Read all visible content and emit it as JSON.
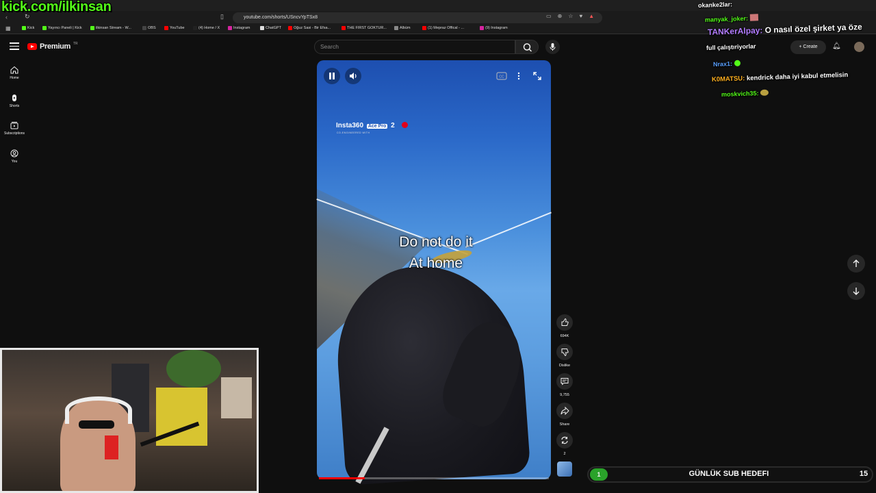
{
  "overlay": {
    "channel_url": "kick.com/ilkinsan"
  },
  "browser": {
    "url": "youtube.com/shorts/USncvYpTSx8",
    "bookmarks": [
      {
        "label": "Kick",
        "color": "#53fc18"
      },
      {
        "label": "Yayıncı Paneli | Kick",
        "color": "#53fc18"
      },
      {
        "label": "ilkinsan Stream - W...",
        "color": "#53fc18"
      },
      {
        "label": "OBS",
        "color": "#444444"
      },
      {
        "label": "YouTube",
        "color": "#ff0000"
      },
      {
        "label": "(4) Home / X",
        "color": "#222222"
      },
      {
        "label": "Instagram",
        "color": "#d6249f"
      },
      {
        "label": "ChatGPT",
        "color": "#dddddd"
      },
      {
        "label": "Oğuz Sasi - Bir Efsa...",
        "color": "#ff0000"
      },
      {
        "label": "THE FIRST GOKTUR...",
        "color": "#ff0000"
      },
      {
        "label": "Albüm",
        "color": "#888888"
      },
      {
        "label": "(1) Mepraz Offical - ...",
        "color": "#ff0000"
      },
      {
        "label": "(9) Instagram",
        "color": "#d6249f"
      }
    ]
  },
  "youtube": {
    "logo": "Premium",
    "logo_tr": "TR",
    "search_placeholder": "Search",
    "create_label": "Create",
    "sidebar": [
      {
        "label": "Home",
        "icon": "home-icon"
      },
      {
        "label": "Shorts",
        "icon": "shorts-icon"
      },
      {
        "label": "Subscriptions",
        "icon": "subscriptions-icon"
      },
      {
        "label": "You",
        "icon": "you-icon"
      }
    ],
    "short": {
      "brand": "Insta360",
      "brand_badge": "Ace Pro",
      "brand_num": "2",
      "brand_sub": "CO-ENGINEERED WITH",
      "caption_line1": "Do not do it",
      "caption_line2": "At home",
      "progress": 0.2
    },
    "actions": {
      "likes": "694K",
      "dislike": "Dislike",
      "comments": "9,755",
      "share": "Share",
      "remix": "2"
    }
  },
  "chat": [
    {
      "user": "okanke2lar:",
      "msg": "",
      "color": "#ffffff"
    },
    {
      "user": "manyak_joker:",
      "msg": "",
      "color": "#53fc18"
    },
    {
      "user": "TANKerAlpay:",
      "msg": "O nasıl özel şirket ya öze",
      "color": "#b27cff"
    },
    {
      "user": "",
      "msg": "full çalıştıriyorlar",
      "color": "#ffffff"
    },
    {
      "user": "Nrax1:",
      "msg": "",
      "color": "#5aa0ff"
    },
    {
      "user": "K0MATSU:",
      "msg": "kendrick daha iyi kabul etmelisin",
      "color": "#ffb020"
    },
    {
      "user": "moskvich35:",
      "msg": "",
      "color": "#53fc18"
    }
  ],
  "subgoal": {
    "current": "1",
    "title": "GÜNLÜK SUB HEDEFI",
    "target": "15"
  }
}
